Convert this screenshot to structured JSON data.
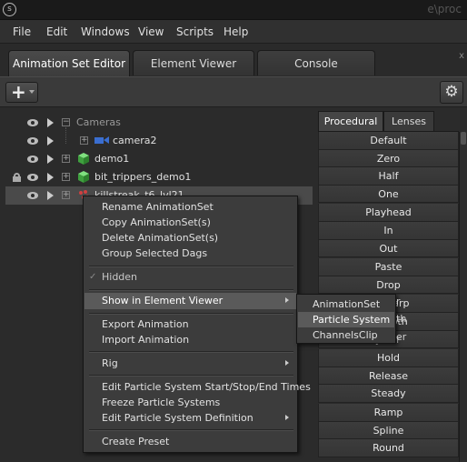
{
  "window": {
    "title_partial": "e\\proc",
    "close_glyph": "x"
  },
  "menubar": {
    "items": [
      "File",
      "Edit",
      "Windows",
      "View",
      "Scripts",
      "Help"
    ]
  },
  "tabs": [
    {
      "label": "Animation Set Editor",
      "active": true
    },
    {
      "label": "Element Viewer",
      "active": false
    },
    {
      "label": "Console",
      "active": false
    }
  ],
  "toolbar": {
    "add_icon": "plus-icon",
    "settings_icon": "gear-icon"
  },
  "tree": {
    "rows": [
      {
        "label": "Cameras",
        "type": "folder"
      },
      {
        "label": "camera2",
        "type": "camera"
      },
      {
        "label": "demo1",
        "type": "dag",
        "color": "#4fc04f"
      },
      {
        "label": "bit_trippers_demo1",
        "type": "dag",
        "color": "#4fc04f",
        "locked": true
      },
      {
        "label": "killstreak_t6_lvl21",
        "type": "dag",
        "color": "#d04040",
        "selected": true
      }
    ]
  },
  "right_panel": {
    "tabs": [
      {
        "label": "Procedural",
        "active": true
      },
      {
        "label": "Lenses",
        "active": false
      }
    ],
    "presets": [
      "Default",
      "Zero",
      "Half",
      "One",
      "Playhead",
      "In",
      "Out",
      "Paste",
      "Drop",
      "Unsharp",
      "Smooth",
      "Jitter",
      "Hold",
      "Release",
      "Steady",
      "Ramp",
      "Spline",
      "Round"
    ],
    "visible_fragments": {
      "unsharp": "r",
      "smooth": "th",
      "jitter": "er"
    }
  },
  "context_menu": {
    "items": [
      "Rename AnimationSet",
      "Copy AnimationSet(s)",
      "Delete AnimationSet(s)",
      "Group Selected Dags",
      "Hidden",
      "Show in Element Viewer",
      "Export Animation",
      "Import Animation",
      "Rig",
      "Edit Particle System Start/Stop/End Times",
      "Freeze Particle Systems",
      "Edit Particle System Definition",
      "Create Preset"
    ],
    "submenu": {
      "items": [
        "AnimationSet",
        "Particle System",
        "ChannelsClip"
      ],
      "highlighted": "Particle System"
    }
  },
  "colors": {
    "accent_highlight": "#5a5a5a",
    "background": "#2b2b2b",
    "green_dag": "#4fc04f",
    "red_dag": "#d04040",
    "camera_blue": "#3a6ed0"
  }
}
